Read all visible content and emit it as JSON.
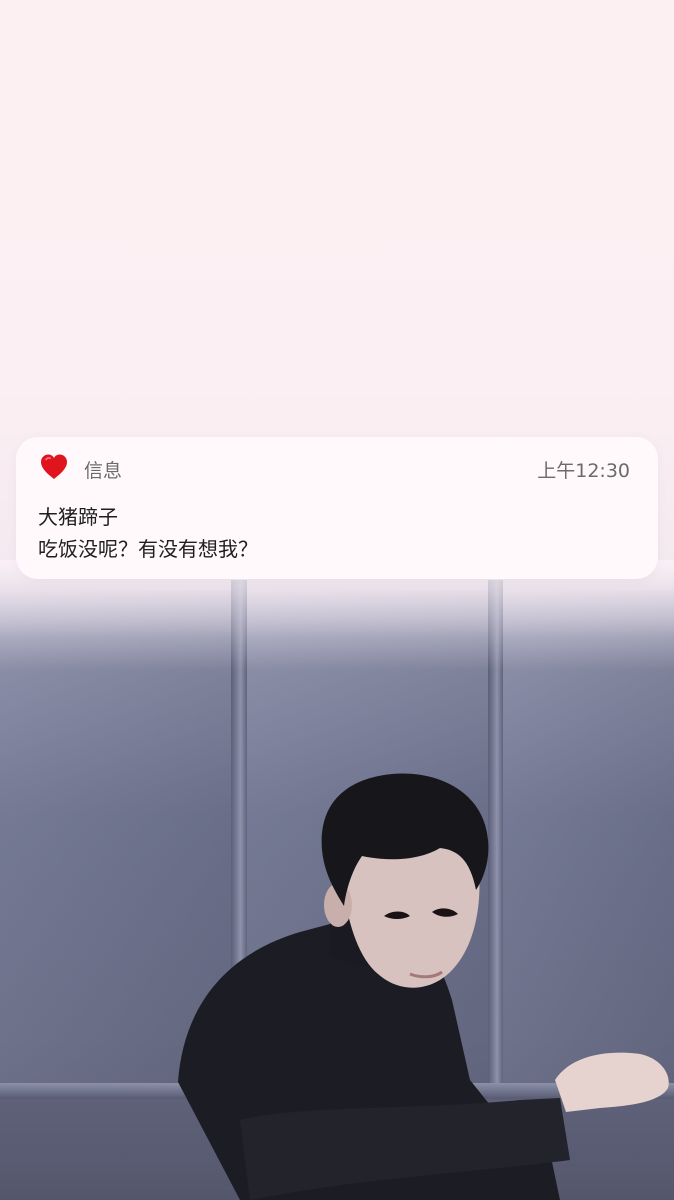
{
  "notification": {
    "app_icon": "heart-icon",
    "app_name": "信息",
    "time": "上午12:30",
    "sender": "大猪蹄子",
    "message": "吃饭没呢？有没有想我？"
  },
  "colors": {
    "heart": "#e0141d",
    "background_top": "#fcf0f3",
    "card_background": "#fffafc",
    "wall": "#6f7490"
  }
}
